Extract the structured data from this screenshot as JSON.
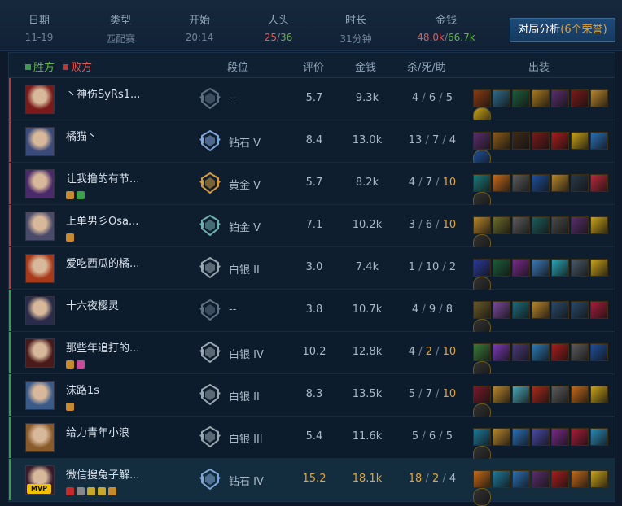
{
  "summary": {
    "date": {
      "label": "日期",
      "value": "11-19"
    },
    "type": {
      "label": "类型",
      "value": "匹配赛"
    },
    "start": {
      "label": "开始",
      "value": "20:14"
    },
    "kills": {
      "label": "人头",
      "ours": "25",
      "sep": "/",
      "theirs": "36"
    },
    "duration": {
      "label": "时长",
      "value": "31分钟"
    },
    "gold": {
      "label": "金钱",
      "ours": "48.0k",
      "sep": "/",
      "theirs": "66.7k"
    }
  },
  "analysis_button": {
    "label": "对局分析",
    "honors": "(6个荣誉)"
  },
  "table": {
    "legend_win": "胜方",
    "legend_loss": "败方",
    "col_rank": "段位",
    "col_score": "评价",
    "col_gold": "金钱",
    "col_kda": "杀/死/助",
    "col_items": "出装"
  },
  "players": [
    {
      "name": "丶神伤SyRs1...",
      "rank": "--",
      "score": "5.7",
      "gold": "9.3k",
      "k": "4",
      "d": "6",
      "a": "5",
      "team": "loss"
    },
    {
      "name": "橘猫丶",
      "rank": "钻石 V",
      "score": "8.4",
      "gold": "13.0k",
      "k": "13",
      "d": "7",
      "a": "4",
      "team": "loss"
    },
    {
      "name": "让我撸的有节...",
      "rank": "黄金 V",
      "score": "5.7",
      "gold": "8.2k",
      "k": "4",
      "d": "7",
      "a": "10",
      "team": "loss"
    },
    {
      "name": "上单男彡Osa...",
      "rank": "铂金 V",
      "score": "7.1",
      "gold": "10.2k",
      "k": "3",
      "d": "6",
      "a": "10",
      "team": "loss"
    },
    {
      "name": "爱吃西瓜的橘...",
      "rank": "白银 II",
      "score": "3.0",
      "gold": "7.4k",
      "k": "1",
      "d": "10",
      "a": "2",
      "team": "loss"
    },
    {
      "name": "十六夜樱灵",
      "rank": "--",
      "score": "3.8",
      "gold": "10.7k",
      "k": "4",
      "d": "9",
      "a": "8",
      "team": "win"
    },
    {
      "name": "那些年追打的...",
      "rank": "白银 IV",
      "score": "10.2",
      "gold": "12.8k",
      "k": "4",
      "d": "2",
      "a": "10",
      "team": "win"
    },
    {
      "name": "沫路1s",
      "rank": "白银 II",
      "score": "8.3",
      "gold": "13.5k",
      "k": "5",
      "d": "7",
      "a": "10",
      "team": "win"
    },
    {
      "name": "给力青年小浪",
      "rank": "白银 III",
      "score": "5.4",
      "gold": "11.6k",
      "k": "5",
      "d": "6",
      "a": "5",
      "team": "win"
    },
    {
      "name": "微信搜兔子解...",
      "rank": "钻石 IV",
      "score": "15.2",
      "gold": "18.1k",
      "k": "18",
      "d": "2",
      "a": "4",
      "team": "win",
      "mvp_label": "MVP"
    }
  ],
  "colors": {
    "win": "#3f9a4d",
    "loss": "#b33a3a",
    "highlight": "#e2a33b",
    "accent": "#1e4a78"
  }
}
